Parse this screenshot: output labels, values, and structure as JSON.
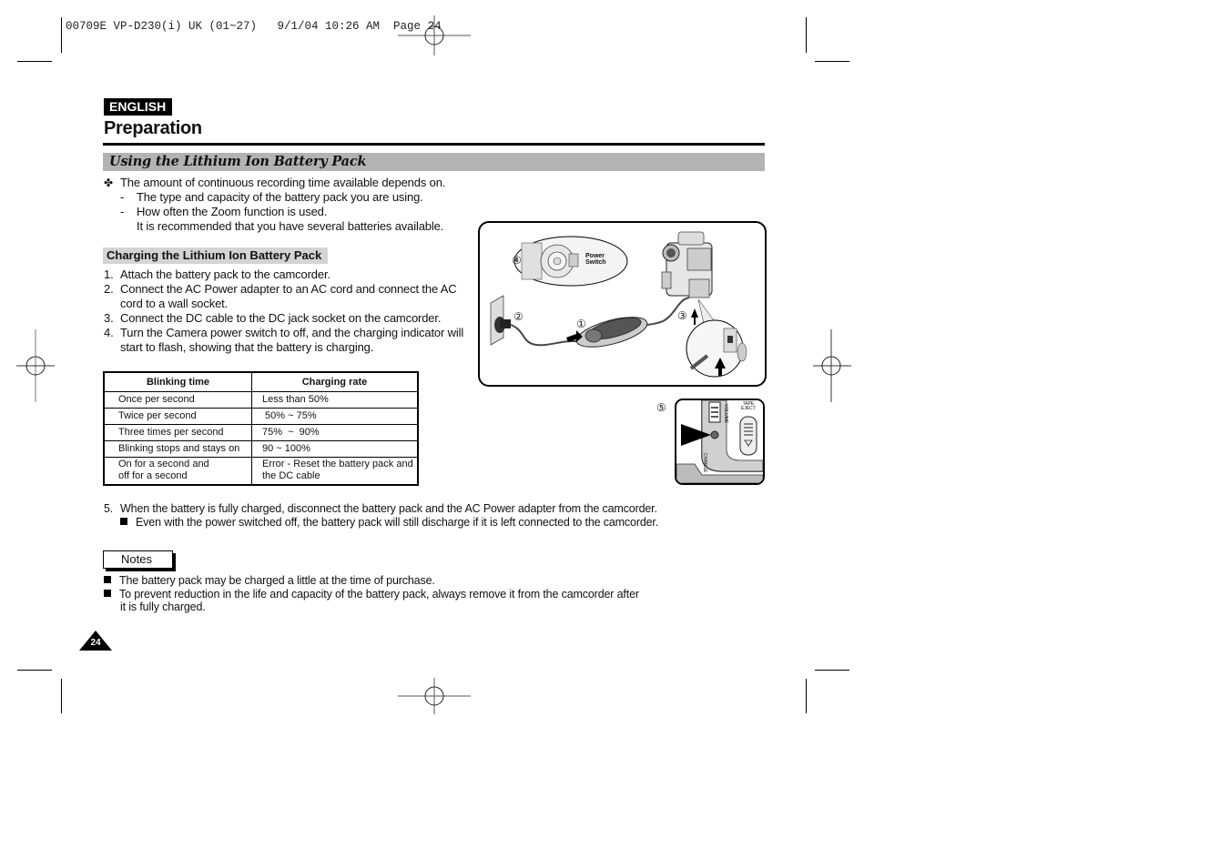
{
  "print_slug": "00709E VP-D230(i) UK (01~27)   9/1/04 10:26 AM  Page 24",
  "language_badge": "ENGLISH",
  "page_title": "Preparation",
  "section_title": "Using the Lithium Ion Battery Pack",
  "intro": {
    "bullet_icon": "four-petal-cross",
    "lead": "The amount of continuous recording time available depends on.",
    "items": [
      "The type and capacity of the battery pack you are using.",
      "How often the Zoom function is used."
    ],
    "recommendation": "It is recommended that you have several batteries available."
  },
  "charging": {
    "heading": "Charging the Lithium Ion Battery Pack",
    "steps": [
      {
        "num": "1.",
        "lines": [
          "Attach the battery pack to the camcorder."
        ]
      },
      {
        "num": "2.",
        "lines": [
          "Connect the AC Power adapter to an AC cord and connect the AC",
          "cord to a wall socket."
        ]
      },
      {
        "num": "3.",
        "lines": [
          "Connect the DC cable to the DC jack socket on the camcorder."
        ]
      },
      {
        "num": "4.",
        "lines": [
          "Turn the Camera power switch to off, and the charging indicator will",
          "start to flash, showing that the battery is charging."
        ]
      }
    ]
  },
  "blink_table": {
    "headers": [
      "Blinking time",
      "Charging rate"
    ],
    "rows": [
      [
        "Once per second",
        "Less than 50%"
      ],
      [
        "Twice per second",
        " 50% ~ 75%"
      ],
      [
        "Three times per second",
        "75%  ~  90%"
      ],
      [
        "Blinking stops and stays on",
        "90 ~ 100%"
      ],
      [
        "On for a second and\noff for a second",
        "Error - Reset the battery pack and\nthe DC cable"
      ]
    ]
  },
  "figure": {
    "callouts": [
      "①",
      "②",
      "③",
      "④",
      "⑤"
    ],
    "power_switch_label": [
      "Power",
      "Switch"
    ],
    "charge_label": "CHARGE",
    "volume_label": "VOLUME",
    "tape_eject_label": [
      "TAPE",
      "EJECT"
    ]
  },
  "step5": {
    "num": "5.",
    "text": "When the battery is fully charged, disconnect the battery pack and the AC Power adapter from the camcorder.",
    "note": "Even with the power switched off, the battery pack will still discharge if it is left connected to the camcorder."
  },
  "notes": {
    "label": "Notes",
    "items": [
      {
        "lines": [
          "The battery pack may be charged a little at the time of purchase."
        ]
      },
      {
        "lines": [
          "To prevent reduction in the life and capacity of the battery pack, always remove it from the camcorder after",
          "it is fully charged."
        ]
      }
    ]
  },
  "page_number": "24"
}
